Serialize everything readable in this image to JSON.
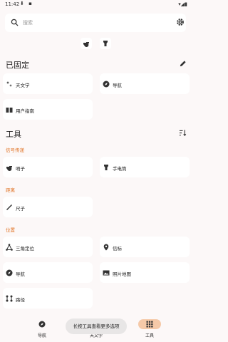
{
  "status": {
    "time": "11:42",
    "left_icons": "⬇ ▪",
    "right_icons": "▾◢▮"
  },
  "search": {
    "placeholder": "搜索"
  },
  "quick_actions": [
    "whistle-icon",
    "flashlight-icon"
  ],
  "pinned": {
    "title": "已固定",
    "items": [
      {
        "label": "天文学",
        "icon": "astronomy-icon"
      },
      {
        "label": "导航",
        "icon": "compass-icon"
      },
      {
        "label": "用户指南",
        "icon": "book-icon"
      }
    ]
  },
  "tools": {
    "title": "工具",
    "categories": [
      {
        "name": "信号传递",
        "items": [
          {
            "label": "哨子",
            "icon": "whistle-icon"
          },
          {
            "label": "手电筒",
            "icon": "flashlight-icon"
          }
        ]
      },
      {
        "name": "距离",
        "items": [
          {
            "label": "尺子",
            "icon": "ruler-icon"
          }
        ]
      },
      {
        "name": "位置",
        "items": [
          {
            "label": "三角定位",
            "icon": "triangulate-icon"
          },
          {
            "label": "信标",
            "icon": "beacon-icon"
          },
          {
            "label": "导航",
            "icon": "compass-icon"
          },
          {
            "label": "照片地图",
            "icon": "photo-map-icon"
          },
          {
            "label": "路径",
            "icon": "paths-icon"
          }
        ]
      }
    ]
  },
  "bottom_nav": [
    {
      "label": "导航",
      "icon": "compass-icon",
      "active": false
    },
    {
      "label": "天文学",
      "icon": "astronomy-icon",
      "active": false
    },
    {
      "label": "工具",
      "icon": "grid-icon",
      "active": true
    }
  ],
  "toast": "长按工具查看更多选项",
  "colors": {
    "accent": "#e07020",
    "active_pill": "#f5c9a8",
    "card": "#ffffff",
    "background": "#fcf8f8"
  }
}
